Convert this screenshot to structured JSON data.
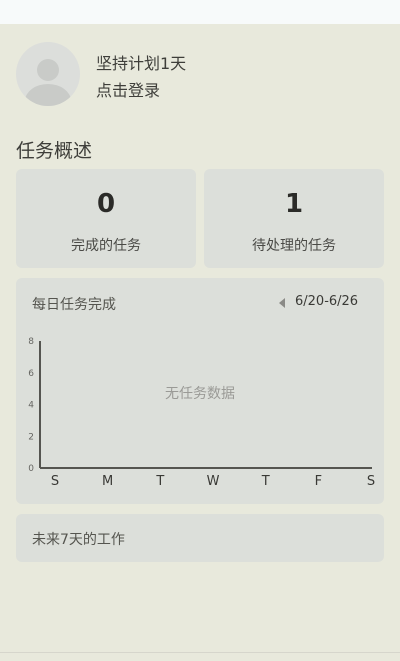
{
  "profile": {
    "motto": "坚持计划1天",
    "login": "点击登录"
  },
  "overview": {
    "title": "任务概述",
    "completed": {
      "value": "0",
      "label": "完成的任务"
    },
    "pending": {
      "value": "1",
      "label": "待处理的任务"
    }
  },
  "daily": {
    "title": "每日任务完成",
    "range": "6/20-6/26",
    "empty_text": "无任务数据"
  },
  "chart_data": {
    "type": "bar",
    "categories": [
      "S",
      "M",
      "T",
      "W",
      "T",
      "F",
      "S"
    ],
    "values": [],
    "ylim": [
      0,
      8
    ],
    "yticks": [
      0,
      2,
      4,
      6,
      8
    ],
    "grid": false
  },
  "future": {
    "title": "未来7天的工作"
  }
}
